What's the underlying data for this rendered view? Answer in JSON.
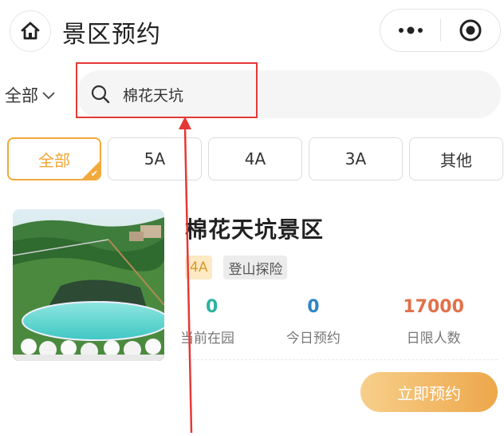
{
  "header": {
    "title": "景区预约",
    "home_icon": "home-icon",
    "more_icon": "more-dots-icon",
    "target_icon": "target-circle-icon"
  },
  "search": {
    "filter_label": "全部",
    "value": "棉花天坑"
  },
  "tabs": [
    {
      "label": "全部",
      "active": true
    },
    {
      "label": "5A",
      "active": false
    },
    {
      "label": "4A",
      "active": false
    },
    {
      "label": "3A",
      "active": false
    },
    {
      "label": "其他",
      "active": false
    }
  ],
  "spot": {
    "name": "棉花天坑景区",
    "level_tag": "4A",
    "type_tag": "登山探险",
    "stats": [
      {
        "value": "0",
        "label": "当前在园"
      },
      {
        "value": "0",
        "label": "今日预约"
      },
      {
        "value": "17000",
        "label": "日限人数"
      }
    ],
    "book_label": "立即预约"
  },
  "colors": {
    "accent": "#f2a93b",
    "annotation": "#e53935",
    "stat_green": "#2bb3a0",
    "stat_blue": "#2c86c6",
    "stat_orange": "#e0704a"
  }
}
